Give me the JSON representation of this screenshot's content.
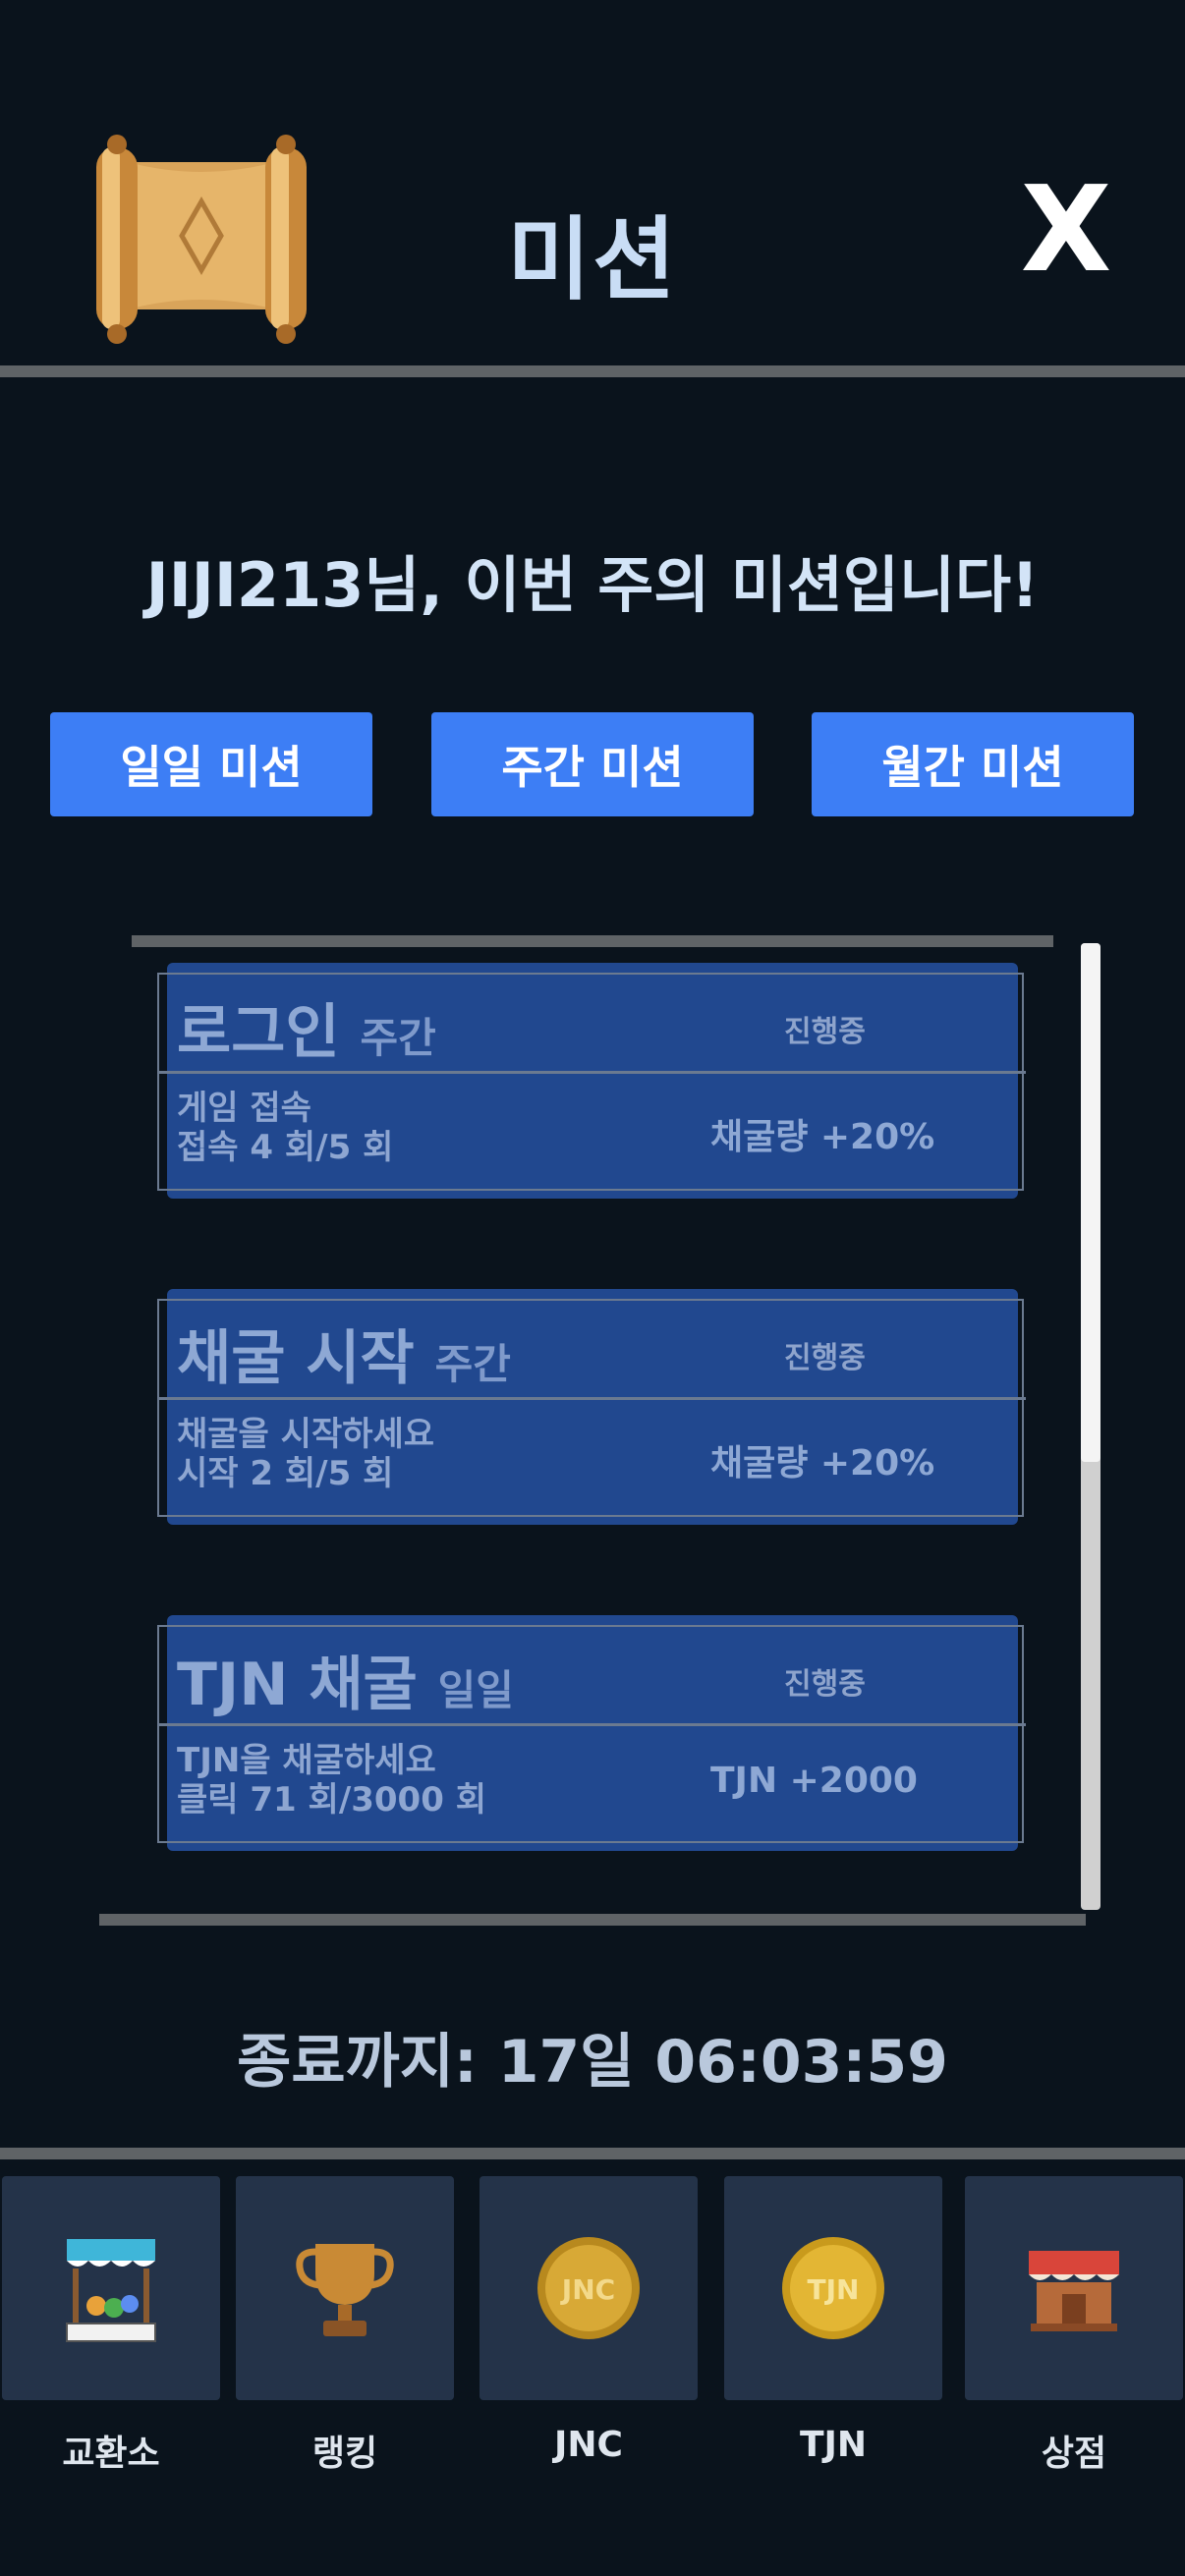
{
  "header": {
    "title": "미션",
    "close_label": "X",
    "icon": "scroll-icon"
  },
  "greeting": "JIJI213님, 이번 주의 미션입니다!",
  "tabs": [
    {
      "label": "일일 미션"
    },
    {
      "label": "주간 미션"
    },
    {
      "label": "월간 미션"
    }
  ],
  "missions": [
    {
      "title": "로그인",
      "period": "주간",
      "status": "진행중",
      "desc": "게임 접속",
      "progress": "접속 4 회/5 회",
      "reward": "채굴량 +20%"
    },
    {
      "title": "채굴 시작",
      "period": "주간",
      "status": "진행중",
      "desc": "채굴을 시작하세요",
      "progress": "시작 2 회/5 회",
      "reward": "채굴량 +20%"
    },
    {
      "title": "TJN 채굴",
      "period": "일일",
      "status": "진행중",
      "desc": "TJN을 채굴하세요",
      "progress": "클릭 71 회/3000 회",
      "reward": "TJN +2000"
    }
  ],
  "scroll_position": 0.0,
  "countdown": "종료까지: 17일 06:03:59",
  "nav": [
    {
      "label": "교환소",
      "icon": "market-stall-icon"
    },
    {
      "label": "랭킹",
      "icon": "trophy-icon"
    },
    {
      "label": "JNC",
      "icon": "jnc-coin-icon",
      "coin_text": "JNC"
    },
    {
      "label": "TJN",
      "icon": "tjn-coin-icon",
      "coin_text": "TJN"
    },
    {
      "label": "상점",
      "icon": "shop-icon"
    }
  ],
  "colors": {
    "background": "#0a131c",
    "tab": "#3d7ef5",
    "card": "#21488f",
    "nav_tile": "#243349"
  }
}
